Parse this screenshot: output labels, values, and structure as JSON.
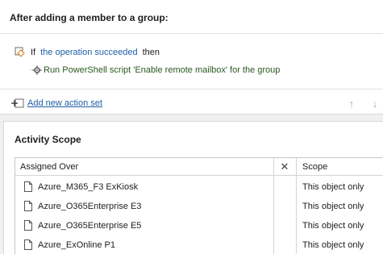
{
  "header": {
    "title": "After adding a member to a group:"
  },
  "condition": {
    "if_label": "If",
    "condition_link": "the operation succeeded",
    "then_label": "then"
  },
  "action": {
    "text": "Run PowerShell script 'Enable remote mailbox' for the group"
  },
  "toolbar": {
    "add_action_set_label": "Add new action set",
    "move_up_glyph": "↑",
    "move_down_glyph": "↓"
  },
  "activity_scope": {
    "title": "Activity Scope",
    "columns": {
      "assigned_over": "Assigned Over",
      "remove_glyph": "✕",
      "scope": "Scope"
    },
    "rows": [
      {
        "name": "Azure_M365_F3 ExKiosk",
        "scope": "This object only"
      },
      {
        "name": "Azure_O365Enterprise E3",
        "scope": "This object only"
      },
      {
        "name": "Azure_O365Enterprise E5",
        "scope": "This object only"
      },
      {
        "name": "Azure_ExOnline P1",
        "scope": "This object only"
      }
    ]
  },
  "colors": {
    "link": "#1f5fa8",
    "action_text": "#2a5a1f",
    "icon_orange": "#e08a1e"
  },
  "icons": {
    "condition": "if-condition-icon",
    "action": "gear-script-icon",
    "add": "add-action-set-icon",
    "row": "document-icon"
  }
}
